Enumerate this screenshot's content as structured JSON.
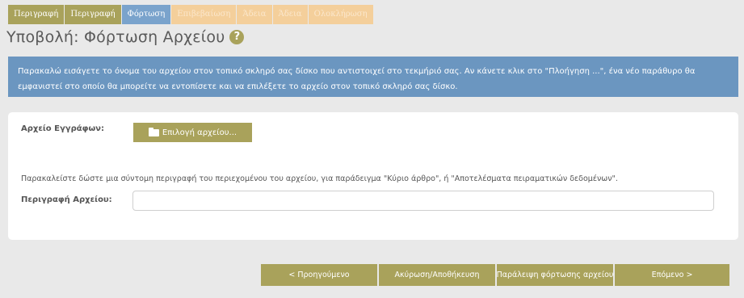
{
  "tabs": [
    {
      "label": "Περιγραφή",
      "state": "done"
    },
    {
      "label": "Περιγραφή",
      "state": "done"
    },
    {
      "label": "Φόρτωση",
      "state": "active"
    },
    {
      "label": "Επιβεβαίωση",
      "state": "todo"
    },
    {
      "label": "Άδεια",
      "state": "todo"
    },
    {
      "label": "Άδεια",
      "state": "todo"
    },
    {
      "label": "Ολοκλήρωση",
      "state": "todo"
    }
  ],
  "page": {
    "title": "Υποβολή: Φόρτωση Αρχείου",
    "help_icon": "question-circle-icon",
    "help_glyph": "?"
  },
  "info": {
    "text": "Παρακαλώ εισάγετε το όνομα του αρχείου στον τοπικό σκληρό σας δίσκο που αντιστοιχεί στο τεκμήριό σας. Αν κάνετε κλικ στο \"Πλοήγηση ...\", ένα νέο παράθυρο θα εμφανιστεί στο οποίο θα μπορείτε να εντοπίσετε και να επιλέξετε το αρχείο στον τοπικό σκληρό σας δίσκο."
  },
  "form": {
    "file_label": "Αρχείο Εγγράφων:",
    "file_button_label": "Επιλογή αρχείου...",
    "hint": "Παρακαλείστε δώστε μια σύντομη περιγραφή του περιεχομένου του αρχείου, για παράδειγμα \"Κύριο άρθρο\", ή \"Αποτελέσματα πειραματικών δεδομένων\".",
    "desc_label": "Περιγραφή Αρχείου:",
    "desc_value": ""
  },
  "nav": {
    "prev": "< Προηγούμενο",
    "cancel": "Ακύρωση/Αποθήκευση",
    "skip": "Παράλειψη φόρτωσης αρχείου",
    "next": "Επόμενο >"
  },
  "colors": {
    "accent": "#a9a25b",
    "info_bg": "#6b96c0",
    "tab_active": "#7aa3cc",
    "tab_todo": "#f4cf9b"
  }
}
